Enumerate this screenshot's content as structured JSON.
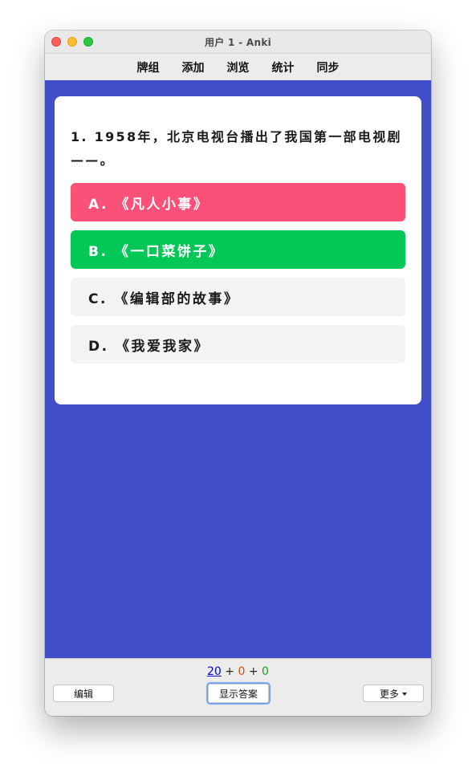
{
  "window": {
    "title": "用户 1 - Anki"
  },
  "toolbar": {
    "items": [
      "牌组",
      "添加",
      "浏览",
      "统计",
      "同步"
    ]
  },
  "card": {
    "question": "1. 1958年，北京电视台播出了我国第一部电视剧——。",
    "options": [
      {
        "label": "A. 《凡人小事》",
        "state": "incorrect"
      },
      {
        "label": "B. 《一口菜饼子》",
        "state": "correct"
      },
      {
        "label": "C. 《编辑部的故事》",
        "state": "neutral"
      },
      {
        "label": "D. 《我爱我家》",
        "state": "neutral"
      }
    ]
  },
  "colors": {
    "background": "#414ec8",
    "incorrect": "#fb5078",
    "correct": "#03c757",
    "neutral": "#f2f3f5"
  },
  "bottom": {
    "counts": {
      "new": "20",
      "learning": "0",
      "review": "0",
      "sep": "+"
    },
    "edit_label": "编辑",
    "show_answer_label": "显示答案",
    "more_label": "更多"
  }
}
